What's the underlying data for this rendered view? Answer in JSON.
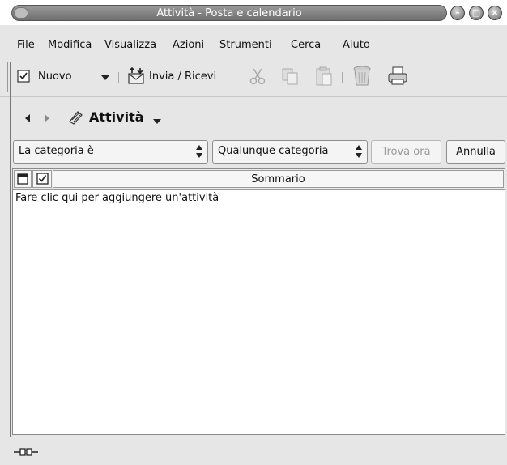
{
  "window": {
    "title": "Attività - Posta e calendario"
  },
  "menubar": {
    "items": [
      {
        "first": "F",
        "rest": "ile"
      },
      {
        "first": "M",
        "rest": "odifica"
      },
      {
        "first": "V",
        "rest": "isualizza"
      },
      {
        "first": "A",
        "rest": "zioni"
      },
      {
        "first": "S",
        "rest": "trumenti"
      },
      {
        "first": "C",
        "rest": "erca"
      },
      {
        "first": "A",
        "rest": "iuto"
      }
    ]
  },
  "toolbar": {
    "new_label": "Nuovo",
    "send_receive_label": "Invia / Ricevi"
  },
  "navigation": {
    "view_title": "Attività"
  },
  "search": {
    "field_selector": "La categoria è",
    "category_selector": "Qualunque categoria",
    "find_label": "Trova ora",
    "cancel_label": "Annulla"
  },
  "task_table": {
    "column_summary": "Sommario",
    "add_task_text": "Fare clic qui per aggiungere un'attività"
  },
  "icons": {
    "window_menu": "window-menu-icon",
    "minimize": "minimize-icon",
    "maximize": "maximize-icon",
    "close": "close-icon",
    "new_task": "checkbox-icon",
    "send_receive": "send-receive-icon",
    "cut": "scissors-icon",
    "copy": "copy-icon",
    "paste": "paste-icon",
    "delete": "trash-icon",
    "print": "printer-icon",
    "back": "back-arrow-icon",
    "forward": "forward-arrow-icon",
    "tasks": "tasks-icon",
    "offline": "connection-plug-icon"
  }
}
